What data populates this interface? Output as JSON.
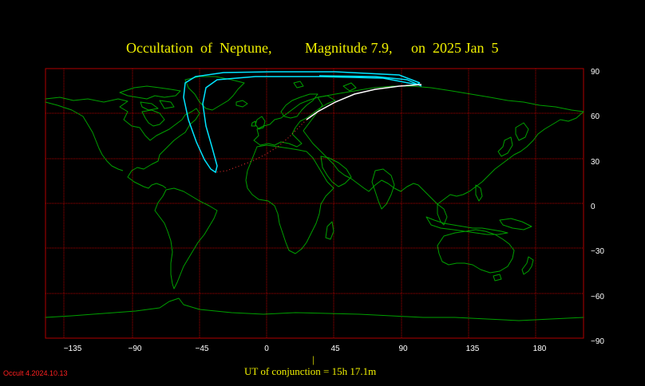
{
  "title": {
    "object": "Occultation  of  Neptune,",
    "magnitude": "Magnitude 7.9,",
    "date": "on  2025 Jan  5"
  },
  "map": {
    "projection": "cylindrical equidistant",
    "lon_ticks": [
      "−135",
      "−90",
      "−45",
      "0",
      "45",
      "90",
      "135",
      "180"
    ],
    "lat_ticks": [
      "90",
      "60",
      "30",
      "0",
      "−30",
      "−60",
      "−90"
    ],
    "colors": {
      "grid": "#b00000",
      "coastline": "#00a000",
      "path_limit": "#00e5ff",
      "central_line": "#ffffff",
      "dotted_path": "#ff3030",
      "title": "#f0f000"
    }
  },
  "footer": {
    "marker": "|",
    "conjunction_label": "UT of conjunction = 15h 17.1m"
  },
  "version": "Occult 4.2024.10.13"
}
